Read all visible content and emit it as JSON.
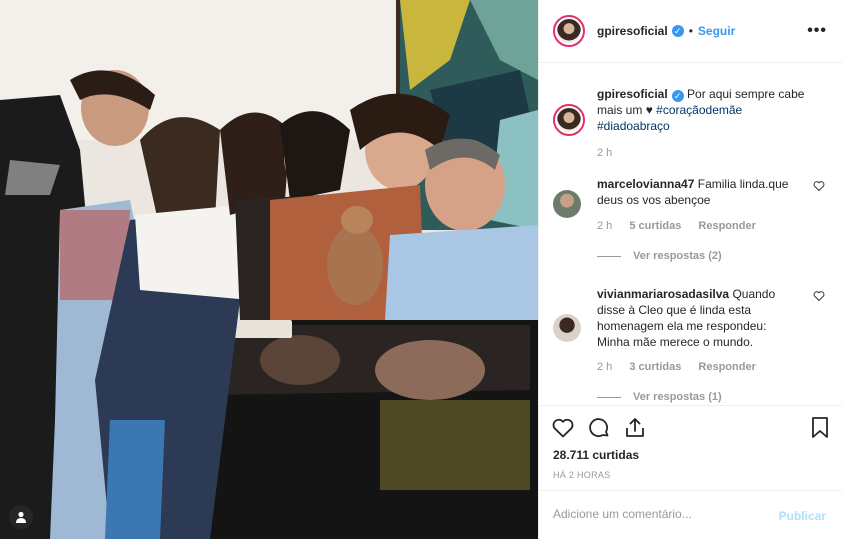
{
  "post": {
    "username": "gpiresoficial",
    "verified": true,
    "follow_label": "Seguir",
    "separator": "•",
    "more_label": "•••"
  },
  "caption": {
    "username": "gpiresoficial",
    "text": "Por aqui sempre cabe mais um",
    "heart": "♥",
    "hashtags": [
      "#coraçãodemãe",
      "#diadoabraço"
    ],
    "time": "2 h"
  },
  "comments": [
    {
      "username": "marcelovianna47",
      "text": "Familia linda.que deus os vos abençoe",
      "time": "2 h",
      "likes": "5 curtidas",
      "reply": "Responder",
      "view_replies": "Ver respostas (2)"
    },
    {
      "username": "vivianmariarosadasilva",
      "text": "Quando disse à Cleo que é linda esta homenagem ela me respondeu: Minha mãe merece o mundo.",
      "time": "2 h",
      "likes": "3 curtidas",
      "reply": "Responder",
      "view_replies": "Ver respostas (1)"
    }
  ],
  "actions": {
    "likes": "28.711 curtidas",
    "posted": "HÁ 2 HORAS"
  },
  "add_comment": {
    "placeholder": "Adicione um comentário...",
    "publish": "Publicar"
  },
  "colors": {
    "accent": "#3897f0",
    "text": "#262626",
    "muted": "#999999",
    "hashtag": "#003569",
    "publish_disabled": "#b2dffc"
  },
  "icons": [
    "user-tag-icon",
    "verified-icon",
    "more-icon",
    "heart-icon",
    "comment-icon",
    "share-icon",
    "bookmark-icon"
  ]
}
